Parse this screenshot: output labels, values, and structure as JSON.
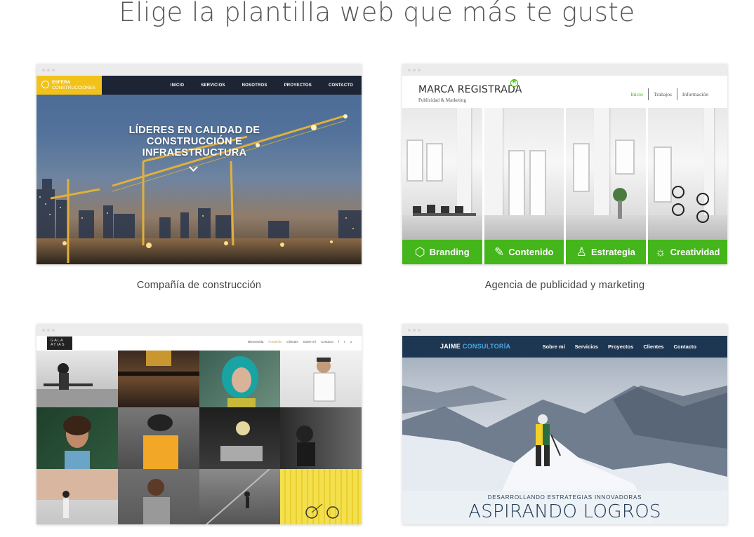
{
  "page": {
    "title": "Elige la plantilla web que más te guste"
  },
  "templates": [
    {
      "caption": "Compañía de construcción",
      "logo": {
        "line1": "ESFERA",
        "line2": "CONSTRUCCIONES"
      },
      "nav": [
        "INICIO",
        "SERVICIOS",
        "NOSOTROS",
        "PROYECTOS",
        "CONTACTO"
      ],
      "headline": "LÍDERES EN CALIDAD DE CONSTRUCCIÓN E INFRAESTRUCTURA",
      "accent": "#f2c21b"
    },
    {
      "caption": "Agencia de publicidad y marketing",
      "brand": "MARCA REGISTRADA",
      "reg_mark": "R",
      "tagline": "Publicidad & Marketing",
      "nav": [
        "Inicio",
        "Trabajos",
        "Información"
      ],
      "services": [
        {
          "label": "Branding",
          "icon": "box-icon"
        },
        {
          "label": "Contenido",
          "icon": "pencil-icon"
        },
        {
          "label": "Estrategia",
          "icon": "chess-piece-icon"
        },
        {
          "label": "Creatividad",
          "icon": "lightbulb-icon"
        }
      ],
      "accent": "#44b51a"
    },
    {
      "caption": "",
      "logo": {
        "line1": "GALA",
        "line2": "ATIAS"
      },
      "nav": [
        "Bienvenida",
        "Portafolio",
        "Clientes",
        "Sobre mí",
        "Contacto"
      ],
      "social": [
        "f",
        "t",
        "o"
      ]
    },
    {
      "caption": "",
      "logo": {
        "first": "JAIME",
        "second": "CONSULTORÍA"
      },
      "nav": [
        "Sobre mí",
        "Servicios",
        "Proyectos",
        "Clientes",
        "Contacto"
      ],
      "subheadline": "DESARROLLANDO ESTRATEGIAS INNOVADORAS",
      "headline": "ASPIRANDO LOGROS",
      "accent": "#1d3651"
    }
  ]
}
